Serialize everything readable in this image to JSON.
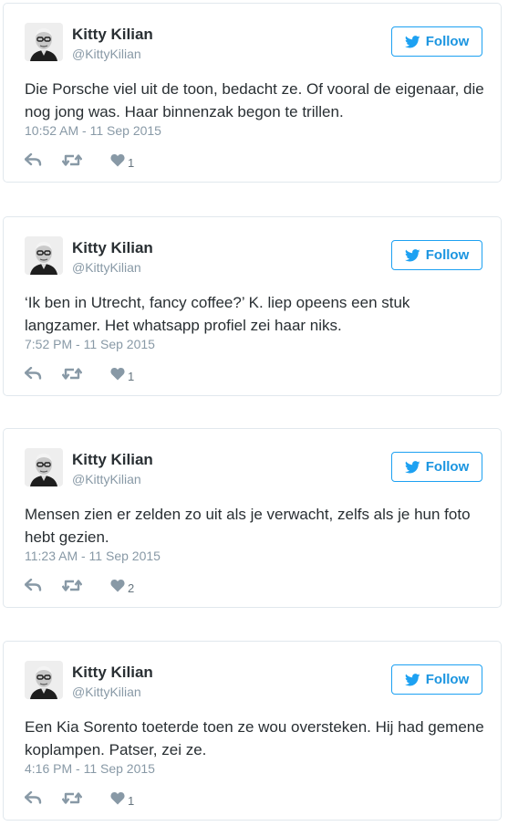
{
  "colors": {
    "accent": "#1da1f2",
    "follow_text": "#1b95e0",
    "meta_gray": "#8899a6",
    "action_gray": "#8899a6",
    "card_border": "#e1e8ed"
  },
  "icons": {
    "follow": "twitter-bird-icon",
    "reply": "reply-arrow-icon",
    "retweet": "retweet-icon",
    "like": "heart-icon"
  },
  "tweets": [
    {
      "name": "Kitty Kilian",
      "handle": "@KittyKilian",
      "follow_label": "Follow",
      "text": "Die Porsche viel uit de toon, bedacht ze. Of vooral de eigenaar, die nog jong was. Haar binnenzak begon te trillen.",
      "timestamp": "10:52 AM - 11 Sep 2015",
      "likes": "1"
    },
    {
      "name": "Kitty Kilian",
      "handle": "@KittyKilian",
      "follow_label": "Follow",
      "text": "‘Ik ben in Utrecht, fancy coffee?’ K. liep opeens een stuk langzamer. Het whatsapp profiel zei haar niks.",
      "timestamp": "7:52 PM - 11 Sep 2015",
      "likes": "1"
    },
    {
      "name": "Kitty Kilian",
      "handle": "@KittyKilian",
      "follow_label": "Follow",
      "text": "Mensen zien er zelden zo uit als je verwacht, zelfs als je hun foto hebt gezien.",
      "timestamp": "11:23 AM - 11 Sep 2015",
      "likes": "2"
    },
    {
      "name": "Kitty Kilian",
      "handle": "@KittyKilian",
      "follow_label": "Follow",
      "text": "Een Kia Sorento toeterde toen ze wou oversteken. Hij had gemene koplampen. Patser, zei ze.",
      "timestamp": "4:16 PM - 11 Sep 2015",
      "likes": "1"
    }
  ]
}
